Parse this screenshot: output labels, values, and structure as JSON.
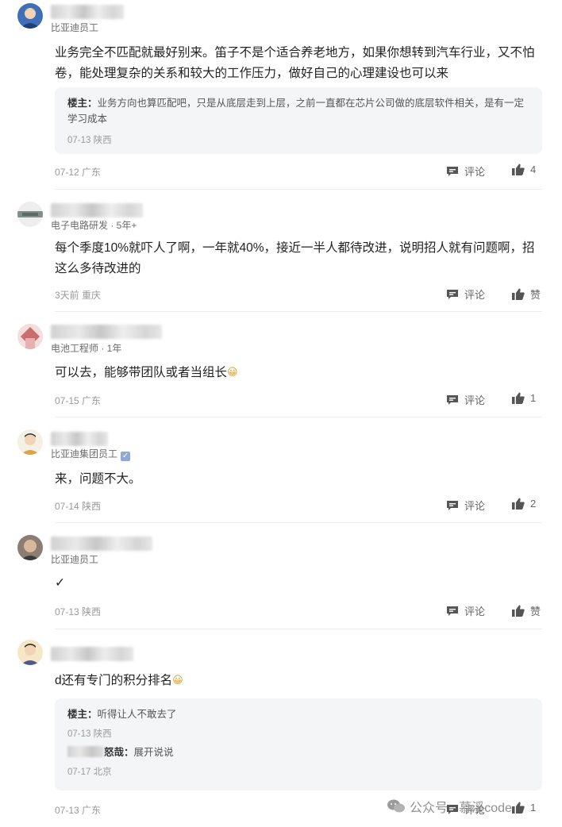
{
  "comments": [
    {
      "subtitle": "比亚迪员工",
      "body": "业务完全不匹配就最好别来。笛子不是个适合养老地方，如果你想转到汽车行业，又不怕卷，能处理复杂的关系和较大的工作压力，做好自己的心理建设也可以来",
      "reply": {
        "host": "楼主：",
        "text": "业务方向也算匹配吧，只是从底层走到上层，之前一直都在芯片公司做的底层软件相关，是有一定学习成本",
        "meta": "07-13 陕西"
      },
      "meta": "07-12 广东",
      "comment_label": "评论",
      "like_label": "4"
    },
    {
      "subtitle": "电子电路研发 · 5年+",
      "body": "每个季度10%就吓人了啊，一年就40%，接近一半人都待改进，说明招人就有问题啊，招这么多待改进的",
      "meta": "3天前 重庆",
      "comment_label": "评论",
      "like_label": "赞"
    },
    {
      "subtitle": "电池工程师 · 1年",
      "body": "可以去，能够带团队或者当组长",
      "meta": "07-15 广东",
      "comment_label": "评论",
      "like_label": "1"
    },
    {
      "subtitle": "比亚迪集团员工",
      "body": "来，问题不大。",
      "meta": "07-14 陕西",
      "comment_label": "评论",
      "like_label": "2"
    },
    {
      "subtitle": "比亚迪员工",
      "body": "✓",
      "meta": "07-13 陕西",
      "comment_label": "评论",
      "like_label": "赞"
    },
    {
      "body": "d还有专门的积分排名",
      "reply": {
        "host": "楼主：",
        "text": "听得让人不敢去了",
        "meta": "07-13 陕西"
      },
      "reply2": {
        "suffix": "怒哉：",
        "text": "展开说说",
        "meta": "07-17 北京"
      },
      "meta": "07-13 广东",
      "comment_label": "评论",
      "like_label": "1"
    }
  ],
  "watermark": "公众号 · 慕溪code",
  "colors": {
    "accent": "#222222",
    "meta": "#9a9a9a",
    "reply_bg": "#f4f5f7"
  },
  "icons": {
    "comment": "comment-icon",
    "like": "thumbs-up-icon",
    "verified": "verified-badge-icon",
    "emoji": "smile-emoji-icon"
  }
}
